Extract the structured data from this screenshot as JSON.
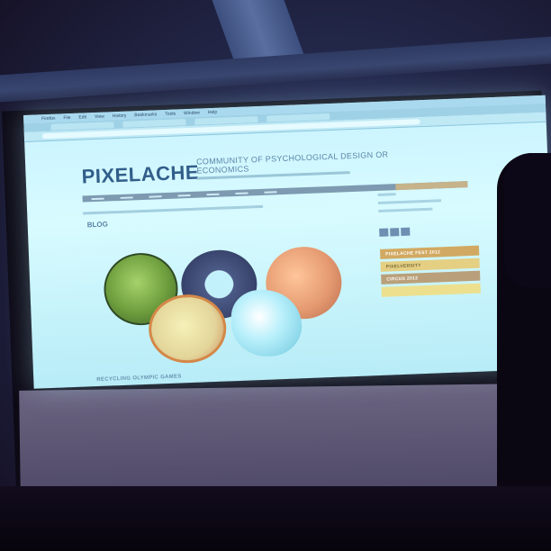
{
  "menubar": {
    "items": [
      "Firefox",
      "File",
      "Edit",
      "View",
      "History",
      "Bookmarks",
      "Tools",
      "Window",
      "Help"
    ]
  },
  "site": {
    "logo": "PIXELACHE",
    "tagline": "COMMUNITY OF PSYCHOLOGICAL DESIGN OR ECONOMICS",
    "section": "BLOG",
    "caption": "RECYCLING OLYMPIC GAMES"
  },
  "sidebar": {
    "promos": [
      "PIXELACHE FEST 2012",
      "PIXELVERSITY",
      "CIRCUS 2012",
      ""
    ]
  },
  "colors": {
    "projection": "#c9f3ff",
    "logo": "#315e8a",
    "promo_gold": "#d2a962"
  }
}
